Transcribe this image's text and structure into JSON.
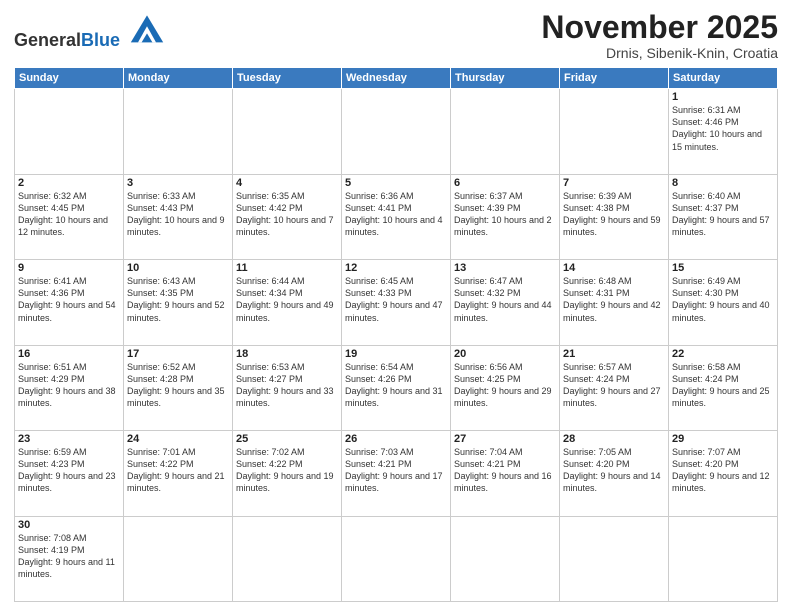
{
  "header": {
    "logo_general": "General",
    "logo_blue": "Blue",
    "month_title": "November 2025",
    "location": "Drnis, Sibenik-Knin, Croatia"
  },
  "weekdays": [
    "Sunday",
    "Monday",
    "Tuesday",
    "Wednesday",
    "Thursday",
    "Friday",
    "Saturday"
  ],
  "weeks": [
    [
      {
        "day": "",
        "info": ""
      },
      {
        "day": "",
        "info": ""
      },
      {
        "day": "",
        "info": ""
      },
      {
        "day": "",
        "info": ""
      },
      {
        "day": "",
        "info": ""
      },
      {
        "day": "",
        "info": ""
      },
      {
        "day": "1",
        "info": "Sunrise: 6:31 AM\nSunset: 4:46 PM\nDaylight: 10 hours and 15 minutes."
      }
    ],
    [
      {
        "day": "2",
        "info": "Sunrise: 6:32 AM\nSunset: 4:45 PM\nDaylight: 10 hours and 12 minutes."
      },
      {
        "day": "3",
        "info": "Sunrise: 6:33 AM\nSunset: 4:43 PM\nDaylight: 10 hours and 9 minutes."
      },
      {
        "day": "4",
        "info": "Sunrise: 6:35 AM\nSunset: 4:42 PM\nDaylight: 10 hours and 7 minutes."
      },
      {
        "day": "5",
        "info": "Sunrise: 6:36 AM\nSunset: 4:41 PM\nDaylight: 10 hours and 4 minutes."
      },
      {
        "day": "6",
        "info": "Sunrise: 6:37 AM\nSunset: 4:39 PM\nDaylight: 10 hours and 2 minutes."
      },
      {
        "day": "7",
        "info": "Sunrise: 6:39 AM\nSunset: 4:38 PM\nDaylight: 9 hours and 59 minutes."
      },
      {
        "day": "8",
        "info": "Sunrise: 6:40 AM\nSunset: 4:37 PM\nDaylight: 9 hours and 57 minutes."
      }
    ],
    [
      {
        "day": "9",
        "info": "Sunrise: 6:41 AM\nSunset: 4:36 PM\nDaylight: 9 hours and 54 minutes."
      },
      {
        "day": "10",
        "info": "Sunrise: 6:43 AM\nSunset: 4:35 PM\nDaylight: 9 hours and 52 minutes."
      },
      {
        "day": "11",
        "info": "Sunrise: 6:44 AM\nSunset: 4:34 PM\nDaylight: 9 hours and 49 minutes."
      },
      {
        "day": "12",
        "info": "Sunrise: 6:45 AM\nSunset: 4:33 PM\nDaylight: 9 hours and 47 minutes."
      },
      {
        "day": "13",
        "info": "Sunrise: 6:47 AM\nSunset: 4:32 PM\nDaylight: 9 hours and 44 minutes."
      },
      {
        "day": "14",
        "info": "Sunrise: 6:48 AM\nSunset: 4:31 PM\nDaylight: 9 hours and 42 minutes."
      },
      {
        "day": "15",
        "info": "Sunrise: 6:49 AM\nSunset: 4:30 PM\nDaylight: 9 hours and 40 minutes."
      }
    ],
    [
      {
        "day": "16",
        "info": "Sunrise: 6:51 AM\nSunset: 4:29 PM\nDaylight: 9 hours and 38 minutes."
      },
      {
        "day": "17",
        "info": "Sunrise: 6:52 AM\nSunset: 4:28 PM\nDaylight: 9 hours and 35 minutes."
      },
      {
        "day": "18",
        "info": "Sunrise: 6:53 AM\nSunset: 4:27 PM\nDaylight: 9 hours and 33 minutes."
      },
      {
        "day": "19",
        "info": "Sunrise: 6:54 AM\nSunset: 4:26 PM\nDaylight: 9 hours and 31 minutes."
      },
      {
        "day": "20",
        "info": "Sunrise: 6:56 AM\nSunset: 4:25 PM\nDaylight: 9 hours and 29 minutes."
      },
      {
        "day": "21",
        "info": "Sunrise: 6:57 AM\nSunset: 4:24 PM\nDaylight: 9 hours and 27 minutes."
      },
      {
        "day": "22",
        "info": "Sunrise: 6:58 AM\nSunset: 4:24 PM\nDaylight: 9 hours and 25 minutes."
      }
    ],
    [
      {
        "day": "23",
        "info": "Sunrise: 6:59 AM\nSunset: 4:23 PM\nDaylight: 9 hours and 23 minutes."
      },
      {
        "day": "24",
        "info": "Sunrise: 7:01 AM\nSunset: 4:22 PM\nDaylight: 9 hours and 21 minutes."
      },
      {
        "day": "25",
        "info": "Sunrise: 7:02 AM\nSunset: 4:22 PM\nDaylight: 9 hours and 19 minutes."
      },
      {
        "day": "26",
        "info": "Sunrise: 7:03 AM\nSunset: 4:21 PM\nDaylight: 9 hours and 17 minutes."
      },
      {
        "day": "27",
        "info": "Sunrise: 7:04 AM\nSunset: 4:21 PM\nDaylight: 9 hours and 16 minutes."
      },
      {
        "day": "28",
        "info": "Sunrise: 7:05 AM\nSunset: 4:20 PM\nDaylight: 9 hours and 14 minutes."
      },
      {
        "day": "29",
        "info": "Sunrise: 7:07 AM\nSunset: 4:20 PM\nDaylight: 9 hours and 12 minutes."
      }
    ],
    [
      {
        "day": "30",
        "info": "Sunrise: 7:08 AM\nSunset: 4:19 PM\nDaylight: 9 hours and 11 minutes."
      },
      {
        "day": "",
        "info": ""
      },
      {
        "day": "",
        "info": ""
      },
      {
        "day": "",
        "info": ""
      },
      {
        "day": "",
        "info": ""
      },
      {
        "day": "",
        "info": ""
      },
      {
        "day": "",
        "info": ""
      }
    ]
  ]
}
